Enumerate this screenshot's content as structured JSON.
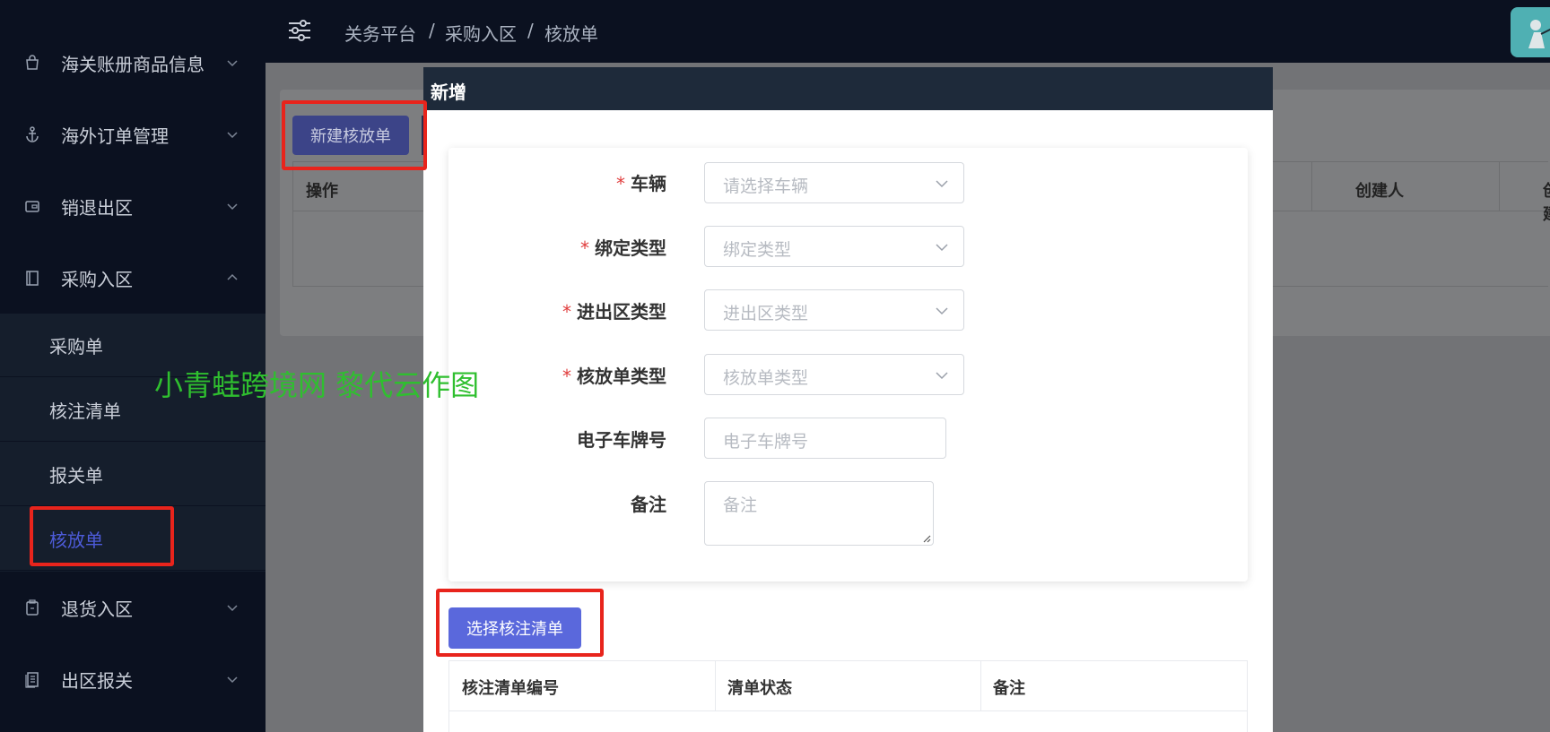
{
  "sidebar": {
    "items": [
      {
        "label": "海关账册商品信息",
        "icon": "bag-icon"
      },
      {
        "label": "海外订单管理",
        "icon": "anchor-icon"
      },
      {
        "label": "销退出区",
        "icon": "wallet-icon"
      },
      {
        "label": "采购入区",
        "icon": "book-icon"
      },
      {
        "label": "退货入区",
        "icon": "clipboard-icon"
      },
      {
        "label": "出区报关",
        "icon": "document-icon"
      }
    ],
    "submenu": [
      {
        "label": "采购单"
      },
      {
        "label": "核注清单"
      },
      {
        "label": "报关单"
      },
      {
        "label": "核放单",
        "active": true
      }
    ]
  },
  "header": {
    "breadcrumb": [
      "关务平台",
      "采购入区",
      "核放单"
    ],
    "separator": "/"
  },
  "page": {
    "new_button": "新建核放单",
    "table_headers": [
      "操作",
      "创建人",
      "创建"
    ]
  },
  "modal": {
    "title": "新增",
    "fields": [
      {
        "label": "车辆",
        "required": true,
        "placeholder": "请选择车辆",
        "type": "select"
      },
      {
        "label": "绑定类型",
        "required": true,
        "placeholder": "绑定类型",
        "type": "select"
      },
      {
        "label": "进出区类型",
        "required": true,
        "placeholder": "进出区类型",
        "type": "select"
      },
      {
        "label": "核放单类型",
        "required": true,
        "placeholder": "核放单类型",
        "type": "select"
      },
      {
        "label": "电子车牌号",
        "required": false,
        "placeholder": "电子车牌号",
        "type": "input"
      },
      {
        "label": "备注",
        "required": false,
        "placeholder": "备注",
        "type": "textarea"
      }
    ],
    "required_mark": "*",
    "pick_button": "选择核注清单",
    "list_headers": [
      "核注清单编号",
      "清单状态",
      "备注"
    ]
  },
  "watermark": "小青蛙跨境网 黎代云作图",
  "colors": {
    "sidebar_bg": "#0b1120",
    "accent": "#5a68dc",
    "annotation_red": "#e8241c",
    "watermark_green": "#2fbf2f"
  }
}
